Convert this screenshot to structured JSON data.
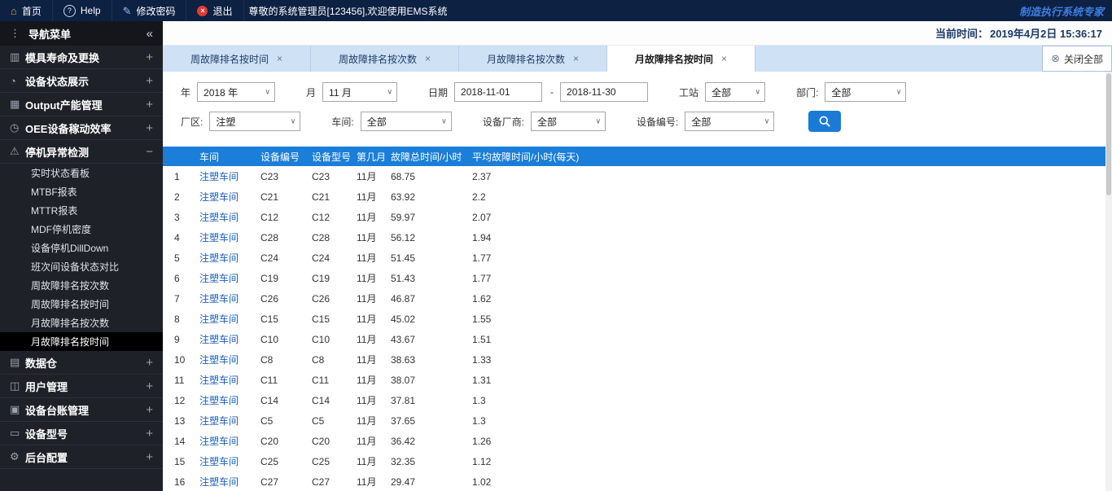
{
  "topbar": {
    "items": [
      {
        "name": "home",
        "icon": "home-icon",
        "glyph": "⌂",
        "label": "首页"
      },
      {
        "name": "help",
        "icon": "help-icon",
        "glyph": "?",
        "label": "Help"
      },
      {
        "name": "change-password",
        "icon": "pencil-icon",
        "glyph": "✎",
        "label": "修改密码"
      },
      {
        "name": "logout",
        "icon": "logout-icon",
        "glyph": "×",
        "label": "退出"
      }
    ],
    "welcome": "尊敬的系统管理员[123456],欢迎使用EMS系统",
    "brand": "制造执行系统专家"
  },
  "nav": {
    "dots_glyph": "⋮",
    "title": "导航菜单",
    "collapse_glyph": "«"
  },
  "timebar": {
    "label": "当前时间：",
    "value": "2019年4月2日 15:36:17"
  },
  "sidebar": {
    "groups": [
      {
        "label": "模具寿命及更换",
        "icon": "mold-life-icon",
        "glyph": "▥",
        "expander": "+",
        "expanded": false
      },
      {
        "label": "设备状态展示",
        "icon": "device-status-icon",
        "glyph": "◔",
        "expander": "+",
        "expanded": false
      },
      {
        "label": "Output产能管理",
        "icon": "output-capacity-icon",
        "glyph": "▦",
        "expander": "+",
        "expanded": false
      },
      {
        "label": "OEE设备稼动效率",
        "icon": "oee-gauge-icon",
        "glyph": "◷",
        "expander": "+",
        "expanded": false
      },
      {
        "label": "停机异常检测",
        "icon": "downtime-warning-icon",
        "glyph": "⚠",
        "expander": "−",
        "expanded": true,
        "items": [
          "实时状态看板",
          "MTBF报表",
          "MTTR报表",
          "MDF停机密度",
          "设备停机DillDown",
          "班次间设备状态对比",
          "周故障排名按次数",
          "周故障排名按时间",
          "月故障排名按次数",
          "月故障排名按时间"
        ],
        "active_item": "月故障排名按时间"
      },
      {
        "label": "数据仓",
        "icon": "data-warehouse-icon",
        "glyph": "▤",
        "expander": "+",
        "expanded": false
      },
      {
        "label": "用户管理",
        "icon": "user-management-icon",
        "glyph": "◫",
        "expander": "+",
        "expanded": false
      },
      {
        "label": "设备台账管理",
        "icon": "device-ledger-icon",
        "glyph": "▣",
        "expander": "+",
        "expanded": false
      },
      {
        "label": "设备型号",
        "icon": "device-model-icon",
        "glyph": "▭",
        "expander": "+",
        "expanded": false
      },
      {
        "label": "后台配置",
        "icon": "gear-icon",
        "glyph": "⚙",
        "expander": "+",
        "expanded": false
      }
    ]
  },
  "tabbar": {
    "tabs": [
      {
        "label": "周故障排名按时间",
        "close_glyph": "×",
        "active": false
      },
      {
        "label": "周故障排名按次数",
        "close_glyph": "×",
        "active": false
      },
      {
        "label": "月故障排名按次数",
        "close_glyph": "×",
        "active": false
      },
      {
        "label": "月故障排名按时间",
        "close_glyph": "×",
        "active": true
      }
    ],
    "close_all": {
      "icon_glyph": "⊗",
      "label": "关闭全部"
    }
  },
  "filters": {
    "row1": [
      {
        "name": "year",
        "label": "年",
        "type": "select",
        "value": "2018 年",
        "chevron": "∨"
      },
      {
        "name": "month",
        "label": "月",
        "type": "select",
        "value": "11 月",
        "chevron": "∨"
      },
      {
        "name": "date-start",
        "label": "日期",
        "type": "input",
        "value": "2018-11-01"
      },
      {
        "name": "date-end",
        "label": "-",
        "type": "input",
        "value": "2018-11-30"
      },
      {
        "name": "station",
        "label": "工站",
        "type": "select",
        "value": "全部",
        "chevron": "∨"
      },
      {
        "name": "department",
        "label": "部门:",
        "type": "select",
        "value": "全部",
        "chevron": "∨"
      }
    ],
    "row2": [
      {
        "name": "plant",
        "label": "厂区:",
        "type": "select",
        "value": "注塑",
        "chevron": "∨"
      },
      {
        "name": "workshop",
        "label": "车间:",
        "type": "select",
        "value": "全部",
        "chevron": "∨"
      },
      {
        "name": "vendor",
        "label": "设备厂商:",
        "type": "select",
        "value": "全部",
        "chevron": "∨"
      },
      {
        "name": "device-no",
        "label": "设备编号:",
        "type": "select",
        "value": "全部",
        "chevron": "∨"
      }
    ]
  },
  "table": {
    "headers": [
      "车间",
      "设备编号",
      "设备型号",
      "第几月",
      "故障总时间/小时",
      "平均故障时间/小时(每天)"
    ],
    "rows": [
      {
        "index": "1",
        "workshop": "注塑车间",
        "device_no": "C23",
        "device_model": "C23",
        "month": "11月",
        "total_hours": "68.75",
        "avg_hours": "2.37"
      },
      {
        "index": "2",
        "workshop": "注塑车间",
        "device_no": "C21",
        "device_model": "C21",
        "month": "11月",
        "total_hours": "63.92",
        "avg_hours": "2.2"
      },
      {
        "index": "3",
        "workshop": "注塑车间",
        "device_no": "C12",
        "device_model": "C12",
        "month": "11月",
        "total_hours": "59.97",
        "avg_hours": "2.07"
      },
      {
        "index": "4",
        "workshop": "注塑车间",
        "device_no": "C28",
        "device_model": "C28",
        "month": "11月",
        "total_hours": "56.12",
        "avg_hours": "1.94"
      },
      {
        "index": "5",
        "workshop": "注塑车间",
        "device_no": "C24",
        "device_model": "C24",
        "month": "11月",
        "total_hours": "51.45",
        "avg_hours": "1.77"
      },
      {
        "index": "6",
        "workshop": "注塑车间",
        "device_no": "C19",
        "device_model": "C19",
        "month": "11月",
        "total_hours": "51.43",
        "avg_hours": "1.77"
      },
      {
        "index": "7",
        "workshop": "注塑车间",
        "device_no": "C26",
        "device_model": "C26",
        "month": "11月",
        "total_hours": "46.87",
        "avg_hours": "1.62"
      },
      {
        "index": "8",
        "workshop": "注塑车间",
        "device_no": "C15",
        "device_model": "C15",
        "month": "11月",
        "total_hours": "45.02",
        "avg_hours": "1.55"
      },
      {
        "index": "9",
        "workshop": "注塑车间",
        "device_no": "C10",
        "device_model": "C10",
        "month": "11月",
        "total_hours": "43.67",
        "avg_hours": "1.51"
      },
      {
        "index": "10",
        "workshop": "注塑车间",
        "device_no": "C8",
        "device_model": "C8",
        "month": "11月",
        "total_hours": "38.63",
        "avg_hours": "1.33"
      },
      {
        "index": "11",
        "workshop": "注塑车间",
        "device_no": "C11",
        "device_model": "C11",
        "month": "11月",
        "total_hours": "38.07",
        "avg_hours": "1.31"
      },
      {
        "index": "12",
        "workshop": "注塑车间",
        "device_no": "C14",
        "device_model": "C14",
        "month": "11月",
        "total_hours": "37.81",
        "avg_hours": "1.3"
      },
      {
        "index": "13",
        "workshop": "注塑车间",
        "device_no": "C5",
        "device_model": "C5",
        "month": "11月",
        "total_hours": "37.65",
        "avg_hours": "1.3"
      },
      {
        "index": "14",
        "workshop": "注塑车间",
        "device_no": "C20",
        "device_model": "C20",
        "month": "11月",
        "total_hours": "36.42",
        "avg_hours": "1.26"
      },
      {
        "index": "15",
        "workshop": "注塑车间",
        "device_no": "C25",
        "device_model": "C25",
        "month": "11月",
        "total_hours": "32.35",
        "avg_hours": "1.12"
      },
      {
        "index": "16",
        "workshop": "注塑车间",
        "device_no": "C27",
        "device_model": "C27",
        "month": "11月",
        "total_hours": "29.47",
        "avg_hours": "1.02"
      }
    ]
  },
  "colors": {
    "topbar_bg": "#0d2143",
    "table_header_bg": "#1b7ed8",
    "link_blue": "#1d5fb8",
    "accent": "#1b7ad6",
    "tabbar_bg": "#cfe1f4"
  }
}
